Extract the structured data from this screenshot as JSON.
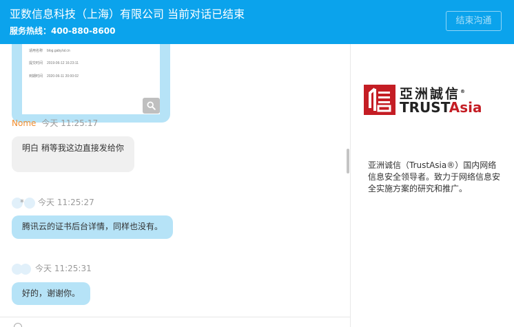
{
  "header": {
    "title": "亚数信息科技（上海）有限公司 当前对话已结束",
    "hotline": "服务热线：400-880-8600",
    "end_button": "结束沟通"
  },
  "image_message": {
    "rows": [
      {
        "key": "适用名称",
        "value": "blog.gaby/al.cn"
      },
      {
        "key": "提交时间",
        "value": "2019-06-12 16:23:11"
      },
      {
        "key": "到期时间",
        "value": "2020-06-11 20:00:02"
      }
    ]
  },
  "messages": [
    {
      "sender": "Nome",
      "time": "今天 11:25:17",
      "text": "明白 稍等我这边直接发给你"
    },
    {
      "sender": "*",
      "time": "今天 11:25:27",
      "text": "腾讯云的证书后台详情，同样也没有。"
    },
    {
      "sender": "",
      "time": "今天 11:25:31",
      "text": "好的，谢谢你。"
    }
  ],
  "sidebar": {
    "logo_cn": "亞洲誠信",
    "logo_reg": "®",
    "logo_en_a": "TRUST",
    "logo_en_b": "Asia",
    "description": "亚洲诚信（TrustAsia®）国内网络信息安全领导者。致力于网络信息安全实施方案的研究和推广。"
  },
  "colors": {
    "header": "#0ba3ec",
    "bubble_blue": "#b6e3f7",
    "bubble_gray": "#f0f0f0",
    "agent_name": "#f08c2e",
    "brand_red": "#c41d24"
  },
  "icons": [
    "search-icon",
    "trustasia-logo-icon"
  ]
}
